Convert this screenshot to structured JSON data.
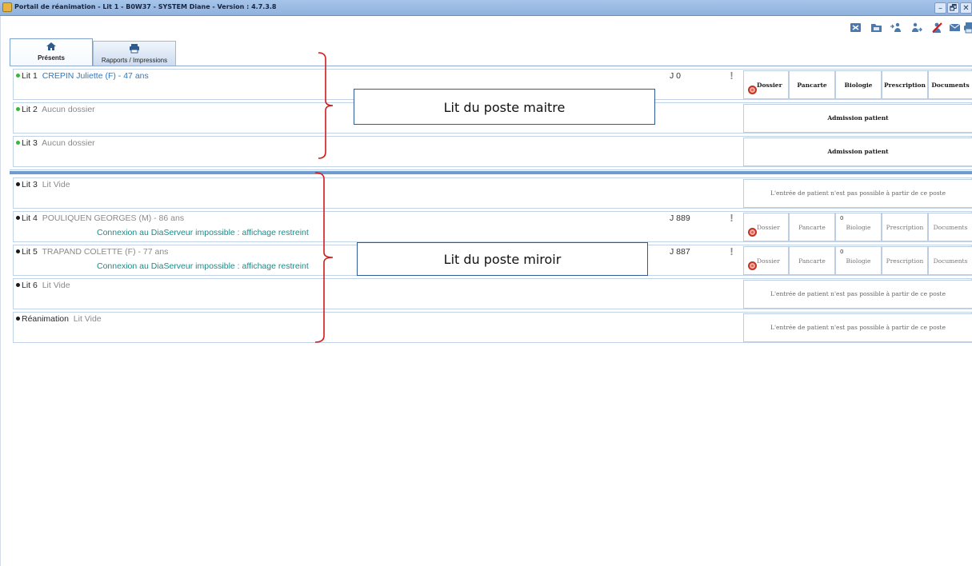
{
  "window": {
    "title": "Portail de réanimation - Lit 1 - B0W37 - SYSTEM Diane - Version : 4.7.3.8",
    "controls": {
      "minimize": "–",
      "maximize": "🗗",
      "close": "✕"
    }
  },
  "toolbar": {
    "icons": [
      "excel-export-icon",
      "folder-icon",
      "transfer-in-icon",
      "transfer-out-icon",
      "user-cancel-icon",
      "mail-icon",
      "print-icon"
    ]
  },
  "tabs": [
    {
      "label": "Présents",
      "icon": "home-icon",
      "active": true
    },
    {
      "label": "Rapports / Impressions",
      "icon": "printer-icon",
      "active": false
    }
  ],
  "master_beds": [
    {
      "bed": "Lit 1",
      "patient": "CREPIN Juliette (F) - 47 ans",
      "day": "J 0",
      "status": "green",
      "kind": "patient"
    },
    {
      "bed": "Lit 2",
      "patient": "Aucun dossier",
      "status": "green",
      "kind": "admission"
    },
    {
      "bed": "Lit 3",
      "patient": "Aucun dossier",
      "status": "green",
      "kind": "admission"
    }
  ],
  "mirror_beds": [
    {
      "bed": "Lit 3",
      "patient": "Lit Vide",
      "status": "black",
      "kind": "empty"
    },
    {
      "bed": "Lit 4",
      "patient": "POULIQUEN GEORGES (M) - 86 ans",
      "day": "J 889",
      "status": "black",
      "kind": "patient",
      "connection": "Connexion au DiaServeur impossible : affichage restreint",
      "bio_count": "0"
    },
    {
      "bed": "Lit 5",
      "patient": "TRAPAND COLETTE (F) - 77 ans",
      "day": "J 887",
      "status": "black",
      "kind": "patient",
      "connection": "Connexion au DiaServeur impossible : affichage restreint",
      "bio_count": "0"
    },
    {
      "bed": "Lit 6",
      "patient": "Lit Vide",
      "status": "black",
      "kind": "empty"
    },
    {
      "bed": "Réanimation",
      "patient": "Lit Vide",
      "status": "black",
      "kind": "empty"
    }
  ],
  "actions": {
    "dossier": "Dossier",
    "pancarte": "Pancarte",
    "biologie": "Biologie",
    "prescription": "Prescription",
    "documents": "Documents",
    "admission": "Admission patient",
    "no_entry": "L'entrée de patient n'est pas possible à partir de ce poste",
    "alert": "!"
  },
  "annotations": {
    "master": "Lit du poste maitre",
    "mirror": "Lit du poste miroir"
  },
  "colors": {
    "titlebar": "#9dbde6",
    "accent": "#2d7ac0",
    "connection_text": "#1e8a87",
    "brace": "#d11a1a",
    "separator": "#6f9bd1",
    "target": "#ef5b4c"
  }
}
